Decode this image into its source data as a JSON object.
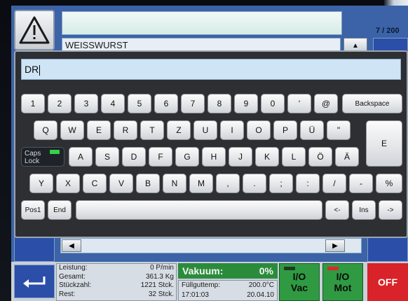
{
  "header": {
    "page_count": "7 / 200",
    "product_name": "WEISSWURST"
  },
  "keyboard": {
    "input_value": "DR",
    "row1": [
      "1",
      "2",
      "3",
      "4",
      "5",
      "6",
      "7",
      "8",
      "9",
      "0",
      "'",
      "@"
    ],
    "backspace_label": "Backspace",
    "row2": [
      "Q",
      "W",
      "E",
      "R",
      "T",
      "Z",
      "U",
      "I",
      "O",
      "P",
      "Ü",
      "\""
    ],
    "enter_label": "E",
    "caps_lock_label": "Caps\nLock",
    "row3": [
      "A",
      "S",
      "D",
      "F",
      "G",
      "H",
      "J",
      "K",
      "L",
      "Ö",
      "Ä"
    ],
    "row4": [
      "Y",
      "X",
      "C",
      "V",
      "B",
      "N",
      "M",
      ",",
      ".",
      ";",
      ":",
      "/",
      "-",
      "%"
    ],
    "pos1_label": "Pos1",
    "end_label": "End",
    "left_label": "<-",
    "ins_label": "Ins",
    "right_label": "->"
  },
  "stats": {
    "rows": [
      {
        "label": "Leistung:",
        "value": "0 P/min"
      },
      {
        "label": "Gesamt:",
        "value": "361.3 Kg"
      },
      {
        "label": "Stückzahl:",
        "value": "1221 Stck."
      },
      {
        "label": "Rest:",
        "value": "32 Stck."
      }
    ]
  },
  "vacuum": {
    "label": "Vakuum:",
    "value": "0%"
  },
  "fill": {
    "temp_label": "Füllguttemp:",
    "temp_value": "200.0°C",
    "time": "17:01:03",
    "date": "20.04.10"
  },
  "controls": {
    "vac_label": "Vac",
    "mot_label": "Mot",
    "io_label": "I/O",
    "off_label": "OFF"
  },
  "colors": {
    "screen_blue": "#3c63a8",
    "vac_green": "#2a8c3b",
    "off_red": "#d8232a",
    "caps_led": "#34d24b"
  }
}
